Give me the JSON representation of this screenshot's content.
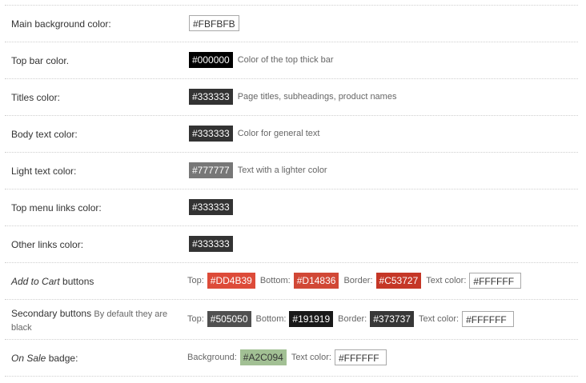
{
  "rows": [
    {
      "label": "Main background color:",
      "value": "#FBFBFB",
      "color": "#FBFBFB",
      "text": "dark",
      "desc": ""
    },
    {
      "label": "Top bar color.",
      "value": "#000000",
      "color": "#000000",
      "text": "light",
      "desc": "Color of the top thick bar"
    },
    {
      "label": "Titles color:",
      "value": "#333333",
      "color": "#333333",
      "text": "light",
      "desc": "Page titles, subheadings, product names"
    },
    {
      "label": "Body text color:",
      "value": "#333333",
      "color": "#333333",
      "text": "light",
      "desc": "Color for general text"
    },
    {
      "label": "Light text color:",
      "value": "#777777",
      "color": "#777777",
      "text": "light",
      "desc": "Text with a lighter color"
    },
    {
      "label": "Top menu links color:",
      "value": "#333333",
      "color": "#333333",
      "text": "light",
      "desc": ""
    },
    {
      "label": "Other links color:",
      "value": "#333333",
      "color": "#333333",
      "text": "light",
      "desc": ""
    }
  ],
  "add_to_cart": {
    "label_em": "Add to Cart",
    "label_rest": " buttons",
    "top_label": "Top:",
    "top": "#DD4B39",
    "top_color": "#DD4B39",
    "bottom_label": "Bottom:",
    "bottom": "#D14836",
    "bottom_color": "#D14836",
    "border_label": "Border:",
    "border": "#C53727",
    "border_color": "#C53727",
    "text_label": "Text color:",
    "text": "#FFFFFF"
  },
  "secondary": {
    "label": "Secondary buttons",
    "hint": "By default they are black",
    "top_label": "Top:",
    "top": "#505050",
    "top_color": "#505050",
    "bottom_label": "Bottom:",
    "bottom": "#191919",
    "bottom_color": "#191919",
    "border_label": "Border:",
    "border": "#373737",
    "border_color": "#373737",
    "text_label": "Text color:",
    "text": "#FFFFFF"
  },
  "on_sale": {
    "label_em": "On Sale",
    "label_rest": " badge:",
    "bg_label": "Background:",
    "bg": "#A2C094",
    "bg_color": "#A2C094",
    "text_label": "Text color:",
    "text": "#FFFFFF"
  }
}
